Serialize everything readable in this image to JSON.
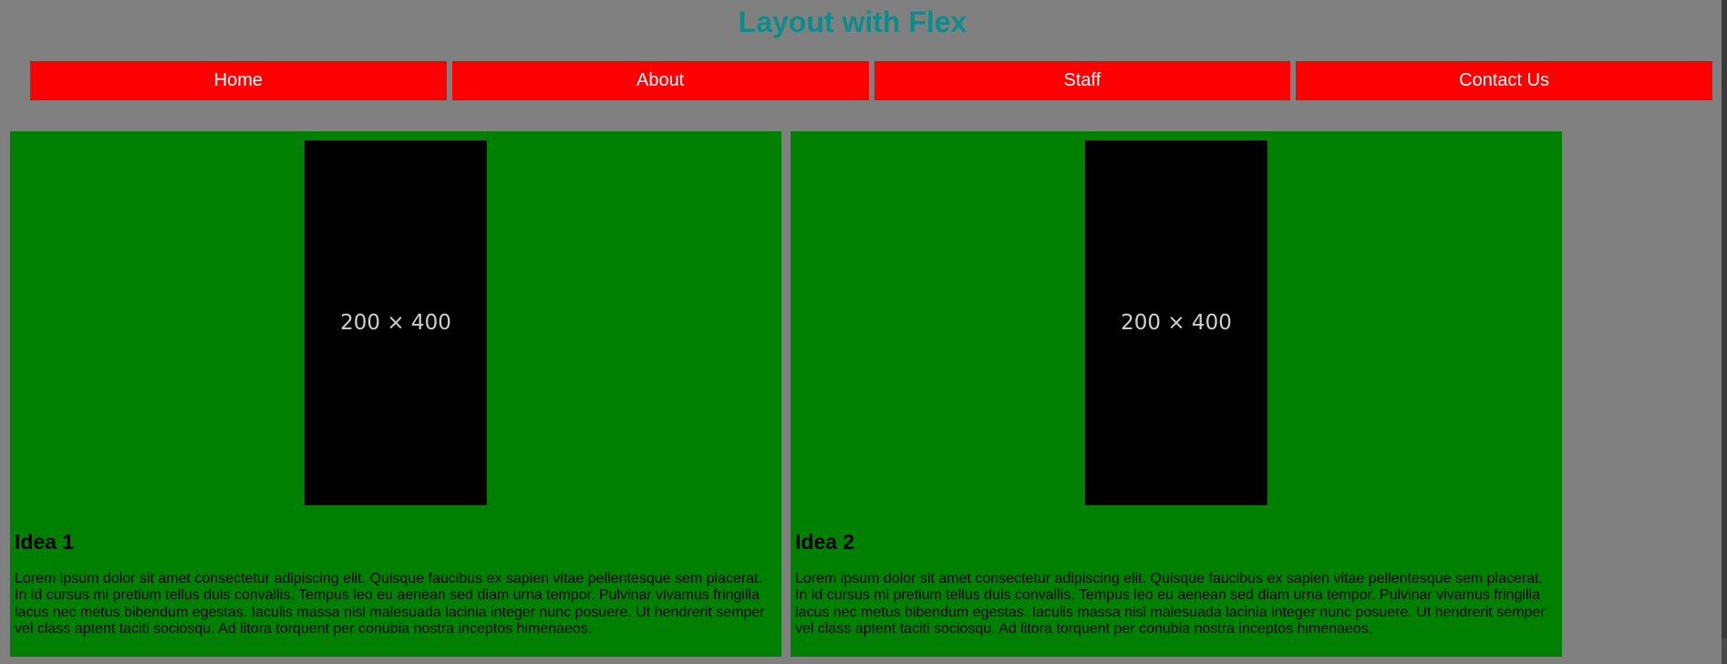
{
  "page": {
    "title": "Layout with Flex",
    "title_color": "#0e8c8c",
    "background": "#808080"
  },
  "nav": {
    "items": [
      {
        "label": "Home"
      },
      {
        "label": "About"
      },
      {
        "label": "Staff"
      },
      {
        "label": "Contact Us"
      }
    ],
    "background": "#ff0000",
    "text_color": "#ffffff"
  },
  "cards": [
    {
      "image_label": "200 × 400",
      "title": "Idea 1",
      "text": "Lorem ipsum dolor sit amet consectetur adipiscing elit. Quisque faucibus ex sapien vitae pellentesque sem placerat. In id cursus mi pretium tellus duis convallis. Tempus leo eu aenean sed diam urna tempor. Pulvinar vivamus fringilla lacus nec metus bibendum egestas. Iaculis massa nisl malesuada lacinia integer nunc posuere. Ut hendrerit semper vel class aptent taciti sociosqu. Ad litora torquent per conubia nostra inceptos himenaeos."
    },
    {
      "image_label": "200 × 400",
      "title": "Idea 2",
      "text": "Lorem ipsum dolor sit amet consectetur adipiscing elit. Quisque faucibus ex sapien vitae pellentesque sem placerat. In id cursus mi pretium tellus duis convallis. Tempus leo eu aenean sed diam urna tempor. Pulvinar vivamus fringilla lacus nec metus bibendum egestas. Iaculis massa nisl malesuada lacinia integer nunc posuere. Ut hendrerit semper vel class aptent taciti sociosqu. Ad litora torquent per conubia nostra inceptos himenaeos."
    }
  ],
  "card_background": "#008000"
}
